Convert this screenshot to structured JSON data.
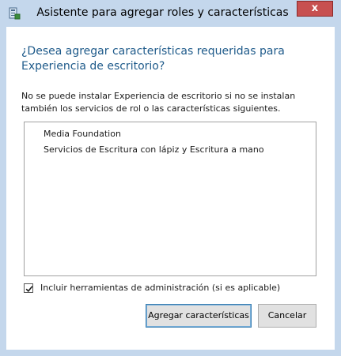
{
  "window": {
    "title": "Asistente para agregar roles y características",
    "close_symbol": "x",
    "app_icon": "server-manager-icon"
  },
  "header": {
    "heading": "¿Desea agregar características requeridas para Experiencia de escritorio?"
  },
  "body": {
    "description": "No se puede instalar Experiencia de escritorio si no se instalan también los servicios de rol o las características siguientes.",
    "features": [
      "Media Foundation",
      "Servicios de Escritura con lápiz y Escritura a mano"
    ]
  },
  "options": {
    "include_tools_label": "Incluir herramientas de administración (si es aplicable)",
    "include_tools_checked": true
  },
  "buttons": {
    "add_features": "Agregar características",
    "cancel": "Cancelar"
  },
  "colors": {
    "frame": "#c4d7ec",
    "heading_text": "#1e5a8a",
    "close_button": "#c75050",
    "default_button_border": "#3c7fb1"
  }
}
